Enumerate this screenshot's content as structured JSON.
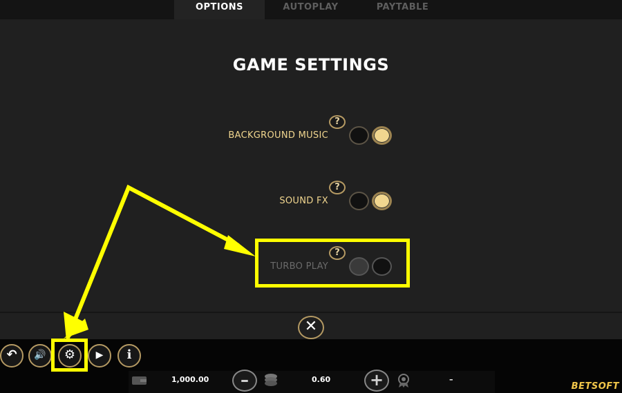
{
  "tabs": [
    {
      "label": "OPTIONS",
      "active": true
    },
    {
      "label": "AUTOPLAY",
      "active": false
    },
    {
      "label": "PAYTABLE",
      "active": false
    }
  ],
  "title": "GAME SETTINGS",
  "settings": [
    {
      "label": "BACKGROUND MUSIC",
      "help": "?",
      "state": "on",
      "enabled": true
    },
    {
      "label": "SOUND FX",
      "help": "?",
      "state": "on",
      "enabled": true
    },
    {
      "label": "TURBO PLAY",
      "help": "?",
      "state": "off",
      "enabled": false
    }
  ],
  "close_glyph": "✕",
  "controls": {
    "back_glyph": "↶",
    "sound_glyph": "🔊",
    "settings_glyph": "⚙",
    "autoplay_glyph": "▶",
    "info_glyph": "i"
  },
  "bet_bar": {
    "balance": "1,000.00",
    "bet": "0.60",
    "win": "–",
    "minus_glyph": "–",
    "plus_glyph": "+"
  },
  "brand": "BETSOFT",
  "colors": {
    "accent": "#b59a63",
    "toggle_on": "#f1d68f",
    "label_gold": "#f1d68f",
    "highlight": "#ffff00"
  }
}
